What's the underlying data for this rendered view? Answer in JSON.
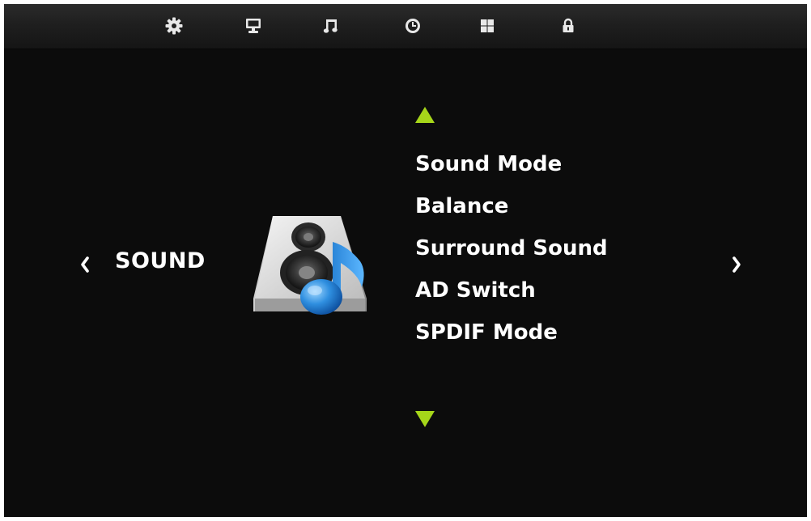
{
  "top_bar": {
    "tabs": [
      {
        "icon": "gear-icon",
        "name": "settings"
      },
      {
        "icon": "monitor-icon",
        "name": "picture"
      },
      {
        "icon": "music-note-icon",
        "name": "sound"
      },
      {
        "icon": "clock-icon",
        "name": "time"
      },
      {
        "icon": "grid-icon",
        "name": "options"
      },
      {
        "icon": "lock-icon",
        "name": "lock"
      }
    ]
  },
  "category": {
    "label": "SOUND",
    "icon": "speaker-music-icon"
  },
  "menu": {
    "items": [
      {
        "label": "Sound Mode"
      },
      {
        "label": "Balance"
      },
      {
        "label": "Surround Sound"
      },
      {
        "label": "AD Switch"
      },
      {
        "label": "SPDIF Mode"
      }
    ]
  },
  "colors": {
    "background": "#0c0c0c",
    "arrow_accent": "#a6d61a",
    "text": "#ffffff"
  }
}
